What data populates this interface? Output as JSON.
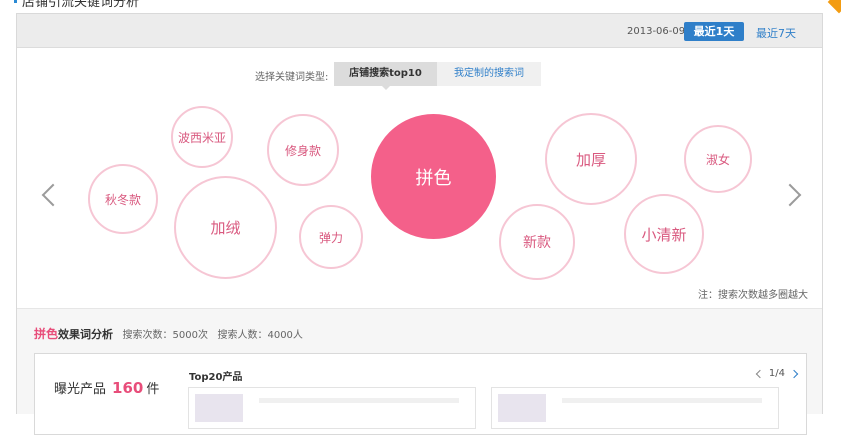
{
  "page": {
    "title": "店铺引流关键词分析"
  },
  "header": {
    "date": "2013-06-09",
    "btn_1day": "最近1天",
    "link_7day": "最近7天"
  },
  "keyword_type": {
    "label": "选择关键词类型:",
    "tabs": [
      {
        "label": "店铺搜索top10",
        "active": true
      },
      {
        "label": "我定制的搜索词",
        "active": false
      }
    ]
  },
  "bubbles": [
    {
      "label": "秋冬款"
    },
    {
      "label": "波西米亚"
    },
    {
      "label": "加绒"
    },
    {
      "label": "修身款"
    },
    {
      "label": "弹力"
    },
    {
      "label": "拼色",
      "active": true
    },
    {
      "label": "新款"
    },
    {
      "label": "加厚"
    },
    {
      "label": "小清新"
    },
    {
      "label": "淑女"
    }
  ],
  "note": "注：搜索次数越多圈越大",
  "analysis": {
    "keyword": "拼色",
    "label": "效果词分析",
    "search_count": "搜索次数：5000次",
    "searcher_count": "搜索人数：4000人"
  },
  "products": {
    "exposure_label": "曝光产品",
    "exposure_count": "160",
    "exposure_unit": "件",
    "top20_title": "Top20产品",
    "pager": "1/4"
  },
  "colors": {
    "accent_blue": "#2f7fc9",
    "bubble_active": "#f4608a",
    "bubble_border": "#f6c6d4",
    "bubble_text": "#d9597f"
  }
}
